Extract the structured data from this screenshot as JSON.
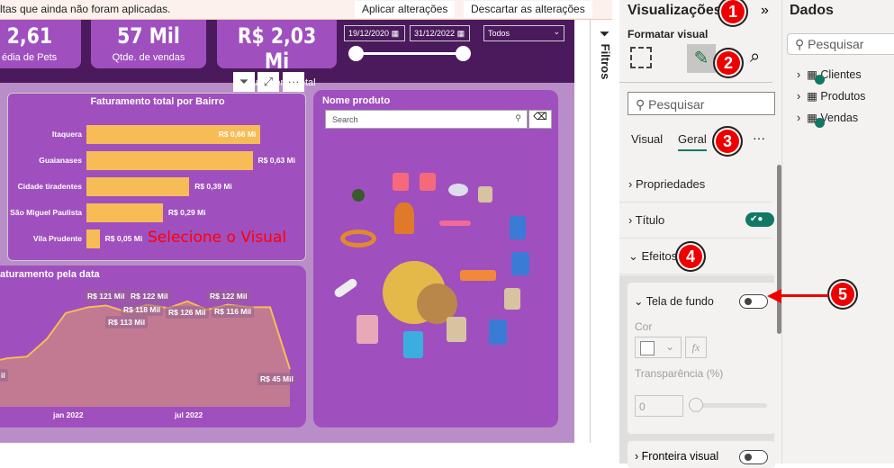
{
  "notification": {
    "message": "ltas que ainda não foram aplicadas.",
    "apply": "Aplicar alterações",
    "discard": "Descartar as alterações"
  },
  "kpis": [
    {
      "value": "2,61",
      "label": "édia de Pets"
    },
    {
      "value": "57 Mil",
      "label": "Qtde. de vendas"
    },
    {
      "value": "R$ 2,03 Mi",
      "label": "Faturamento total"
    }
  ],
  "date_slicer": {
    "start": "19/12/2020",
    "end": "31/12/2022"
  },
  "dropdown": {
    "selected": "Todos"
  },
  "bar_chart": {
    "title": "Faturamento total por Bairro",
    "categories": [
      "Itaquera",
      "Guaianases",
      "Cidade tiradentes",
      "São Miguel Paulista",
      "Vila Prudente"
    ],
    "values": [
      0.66,
      0.63,
      0.39,
      0.29,
      0.05
    ],
    "labels": [
      "R$ 0,66 Mi",
      "R$ 0,63 Mi",
      "R$ 0,39 Mi",
      "R$ 0,29 Mi",
      "R$ 0,05 Mi"
    ],
    "max": 0.7,
    "bar_color": "#f7bc55"
  },
  "annotation": "Selecione o Visual",
  "line_chart": {
    "title": "aturamento pela data",
    "values": [
      56,
      58,
      60,
      81,
      112,
      119,
      121,
      113,
      122,
      118,
      126,
      116,
      122,
      119,
      119,
      45
    ],
    "labels": [
      "R$ 121 Mil",
      "R$ 122 Mil",
      "R$ 118 Mil",
      "R$ 113 Mil",
      "R$ 126 Mil",
      "R$ 122 Mil",
      "R$ 116 Mil",
      "R$ 45 Mil",
      "il"
    ],
    "x_ticks": [
      "jan 2022",
      "jul 2022"
    ]
  },
  "slicer": {
    "title": "Nome produto",
    "search_placeholder": "Search"
  },
  "filters": {
    "label": "Filtros"
  },
  "viz_pane": {
    "title": "Visualizações",
    "subtitle": "Formatar visual",
    "search_placeholder": "Pesquisar",
    "tabs": [
      "Visual",
      "Geral"
    ],
    "sections": [
      "Propriedades",
      "Título",
      "Efeitos"
    ],
    "card": {
      "title": "Tela de fundo",
      "color_label": "Cor",
      "fx": "fx",
      "transparency_label": "Transparência (%)",
      "transparency_value": "0"
    },
    "next_card": "Fronteira visual"
  },
  "data_pane": {
    "title": "Dados",
    "search_placeholder": "Pesquisar",
    "tables": [
      "Clientes",
      "Produtos",
      "Vendas"
    ]
  },
  "badges": [
    "1",
    "2",
    "3",
    "4",
    "5"
  ]
}
